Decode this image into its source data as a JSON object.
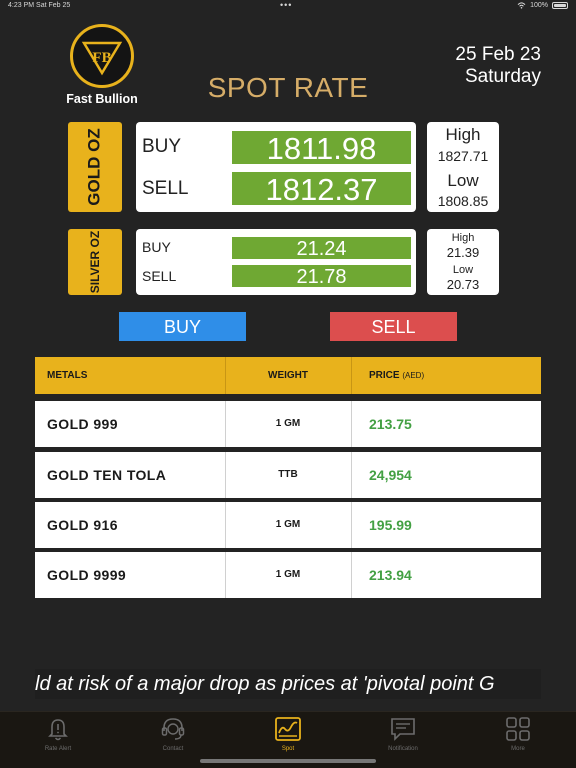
{
  "status_bar": {
    "time": "4:23 PM",
    "date": "Sat Feb 25",
    "dots": "•••",
    "battery": "100%"
  },
  "brand": {
    "name": "Fast Bullion",
    "monogram": "FB"
  },
  "header": {
    "date": "25 Feb 23",
    "day": "Saturday",
    "title": "SPOT RATE"
  },
  "gold": {
    "tab_label": "GOLD OZ",
    "buy_label": "BUY",
    "buy": "1811.98",
    "sell_label": "SELL",
    "sell": "1812.37",
    "high_label": "High",
    "high": "1827.71",
    "low_label": "Low",
    "low": "1808.85"
  },
  "silver": {
    "tab_label": "SILVER OZ",
    "buy_label": "BUY",
    "buy": "21.24",
    "sell_label": "SELL",
    "sell": "21.78",
    "high_label": "High",
    "high": "21.39",
    "low_label": "Low",
    "low": "20.73"
  },
  "actions": {
    "buy": "BUY",
    "sell": "SELL"
  },
  "table": {
    "headers": {
      "metals": "METALS",
      "weight": "WEIGHT",
      "price": "PRICE",
      "price_unit": "(AED)"
    },
    "rows": [
      {
        "metal": "GOLD 999",
        "weight": "1 GM",
        "price": "213.75"
      },
      {
        "metal": "GOLD TEN TOLA",
        "weight": "TTB",
        "price": "24,954"
      },
      {
        "metal": "GOLD 916",
        "weight": "1 GM",
        "price": "195.99"
      },
      {
        "metal": "GOLD 9999",
        "weight": "1 GM",
        "price": "213.94"
      }
    ]
  },
  "ticker": {
    "text": "ld at risk of a major drop as prices at 'pivotal point  G"
  },
  "tabs": [
    {
      "label": "Rate Alert",
      "icon": "bell-icon"
    },
    {
      "label": "Contact",
      "icon": "headset-icon"
    },
    {
      "label": "Spot",
      "icon": "chart-icon",
      "active": true
    },
    {
      "label": "Notification",
      "icon": "message-icon"
    },
    {
      "label": "More",
      "icon": "grid-icon"
    }
  ],
  "colors": {
    "accent": "#e8b21c",
    "value_green": "#6fa833",
    "buy_blue": "#2f8ee8",
    "sell_red": "#dc4e4e",
    "title_gold": "#d6ad68"
  }
}
